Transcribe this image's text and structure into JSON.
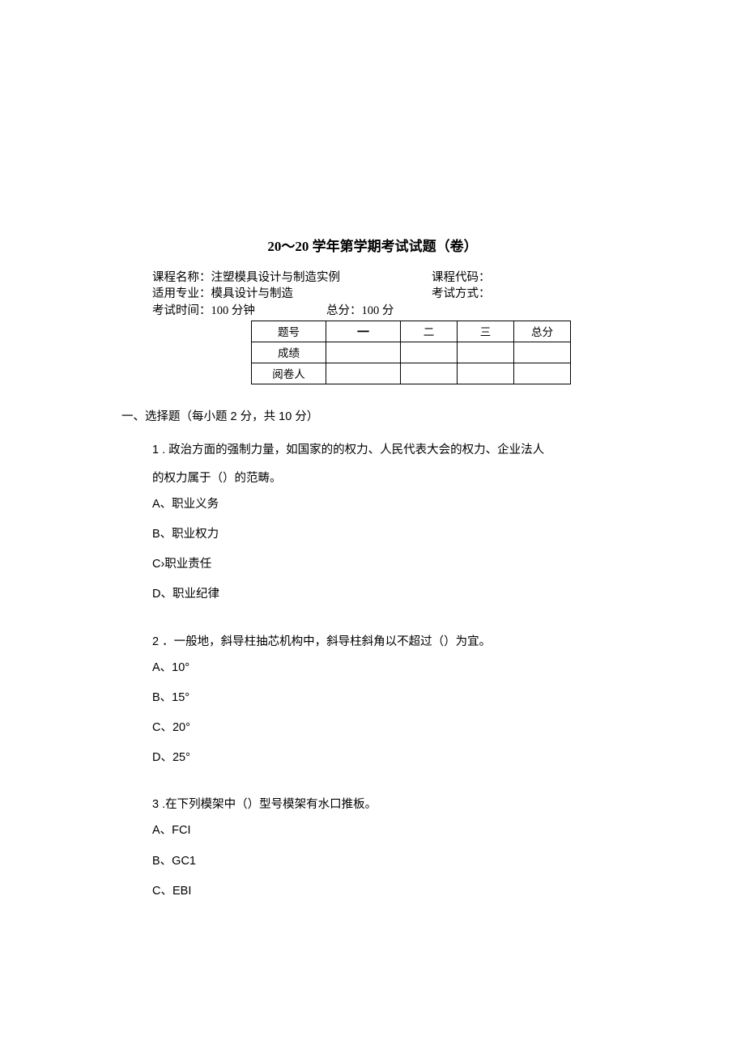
{
  "title": "20～20 学年第学期考试试题（卷）",
  "meta": {
    "course_name_label": "课程名称：",
    "course_name": "注塑模具设计与制造实例",
    "course_code_label": "课程代码：",
    "major_label": "适用专业：",
    "major": "模具设计与制造",
    "exam_mode_label": "考试方式：",
    "time_label": "考试时间：",
    "time": "100 分钟",
    "total_score_label": "总分：",
    "total_score": "100 分"
  },
  "table": {
    "row1_label": "题号",
    "col1": "一",
    "col2": "二",
    "col3": "三",
    "col_total": "总分",
    "row2_label": "成绩",
    "row3_label": "阅卷人"
  },
  "section1_heading": "一、选择题（每小题 2 分，共 10 分）",
  "q1": {
    "text_line1": "1 . 政治方面的强制力量，如国家的的权力、人民代表大会的权力、企业法人",
    "text_line2": "的权力属于（）的范畴。",
    "optA": "A、职业义务",
    "optB": "B、职业权力",
    "optC": "C›职业责任",
    "optD": "D、职业纪律"
  },
  "q2": {
    "text": "2 ．一般地，斜导柱抽芯机构中，斜导柱斜角以不超过（）为宜。",
    "optA": "A、10°",
    "optB": "B、15°",
    "optC": "C、20°",
    "optD": "D、25°"
  },
  "q3": {
    "text": "3 .在下列模架中（）型号模架有水口推板。",
    "optA": "A、FCI",
    "optB": "B、GC1",
    "optC": "C、EBI"
  }
}
